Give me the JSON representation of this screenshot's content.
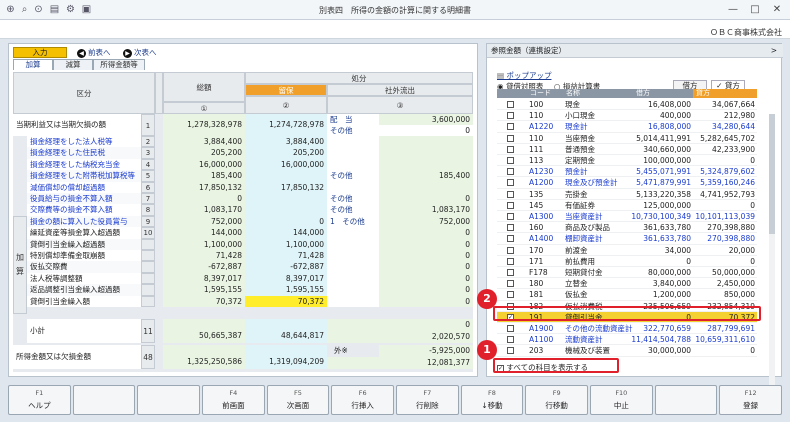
{
  "window": {
    "title": "別表四　所得の金額の計算に関する明細書",
    "company": "ＯＢＣ商事株式会社"
  },
  "nav": {
    "input": "入力",
    "prev": "前表へ",
    "next": "次表へ"
  },
  "tabs": [
    "加算",
    "減算",
    "所得金額等"
  ],
  "grid": {
    "header": {
      "kubun": "区分",
      "sougaku": "総額",
      "shobun": "処分",
      "ryuho": "留保",
      "shagai": "社外流出",
      "c1": "①",
      "c2": "②",
      "c3": "③"
    },
    "side_label": "加 算",
    "rows": [
      {
        "no": "1",
        "label": "当期利益又は当期欠損の額",
        "total": "1,278,328,978",
        "ryuho": "1,274,728,978",
        "shagai_label": "配　当",
        "shagai": "3,600,000",
        "shagai_label2": "その他",
        "shagai2": "0"
      },
      {
        "no": "2",
        "label": "損金経理をした法人税等",
        "total": "3,884,400",
        "ryuho": "3,884,400"
      },
      {
        "no": "3",
        "label": "損金経理をした住民税",
        "total": "205,200",
        "ryuho": "205,200"
      },
      {
        "no": "4",
        "label": "損金経理をした納税充当金",
        "total": "16,000,000",
        "ryuho": "16,000,000"
      },
      {
        "no": "5",
        "label": "損金経理をした附帯税加算税等",
        "total": "185,400",
        "ryuho": "",
        "shagai_label": "その他",
        "shagai": "185,400"
      },
      {
        "no": "6",
        "label": "減価償却の償却超過額",
        "total": "17,850,132",
        "ryuho": "17,850,132"
      },
      {
        "no": "7",
        "label": "役員給与の損金不算入額",
        "total": "0",
        "ryuho": "",
        "shagai_label": "その他",
        "shagai": "0"
      },
      {
        "no": "8",
        "label": "交際費等の損金不算入額",
        "total": "1,083,170",
        "ryuho": "",
        "shagai_label": "その他",
        "shagai": "1,083,170"
      },
      {
        "no": "9",
        "label": "損金の額に算入した役員賞与",
        "total": "752,000",
        "ryuho": "0",
        "shagai_label": "1　その他",
        "shagai": "752,000"
      },
      {
        "no": "10",
        "label": "繰延資産等損金算入超過額",
        "total": "144,000",
        "ryuho": "144,000",
        "shagai": "0"
      },
      {
        "no": "",
        "label": "貸倒引当金繰入超過額",
        "total": "1,100,000",
        "ryuho": "1,100,000",
        "shagai": "0"
      },
      {
        "no": "",
        "label": "特別償却準備金取崩額",
        "total": "71,428",
        "ryuho": "71,428",
        "shagai": "0"
      },
      {
        "no": "",
        "label": "仮払交際費",
        "total": "-672,887",
        "ryuho": "-672,887",
        "shagai": "0"
      },
      {
        "no": "",
        "label": "法人税等調整額",
        "total": "8,397,017",
        "ryuho": "8,397,017",
        "shagai": "0"
      },
      {
        "no": "",
        "label": "返品調整引当金繰入超過額",
        "total": "1,595,155",
        "ryuho": "1,595,155",
        "shagai": "0"
      },
      {
        "no": "",
        "label": "貸倒引当金繰入額",
        "total": "70,372",
        "ryuho": "70,372",
        "shagai": "0"
      }
    ],
    "subtotal": {
      "no": "11",
      "label": "小計",
      "total": "50,665,387",
      "ryuho": "48,644,817",
      "shagai_top": "0",
      "shagai": "2,020,570"
    },
    "last": {
      "no": "48",
      "label": "所得金額又は欠損金額",
      "total": "1,325,250,586",
      "ryuho": "1,319,094,209",
      "gai_label": "外※",
      "shagai_top": "-5,925,000",
      "shagai": "12,081,377"
    }
  },
  "ref": {
    "title": "参照金額（連携設定）",
    "popup": "ポップアップ",
    "radio1": "貸借対照表",
    "radio2": "損益計算書",
    "seg1": "借方",
    "seg2": "貸方",
    "cols": [
      "コード",
      "名称",
      "借方",
      "貸方"
    ],
    "rows": [
      {
        "code": "100",
        "name": "現金",
        "debit": "16,408,000",
        "credit": "34,067,664"
      },
      {
        "code": "110",
        "name": "小口現金",
        "debit": "400,000",
        "credit": "212,980"
      },
      {
        "code": "A1220",
        "name": "現金計",
        "debit": "16,808,000",
        "credit": "34,280,644",
        "blue": true
      },
      {
        "code": "110",
        "name": "当座預金",
        "debit": "5,014,411,991",
        "credit": "5,282,645,702"
      },
      {
        "code": "111",
        "name": "普通預金",
        "debit": "340,660,000",
        "credit": "42,233,900"
      },
      {
        "code": "113",
        "name": "定期預金",
        "debit": "100,000,000",
        "credit": "0"
      },
      {
        "code": "A1230",
        "name": "預金計",
        "debit": "5,455,071,991",
        "credit": "5,324,879,602",
        "blue": true
      },
      {
        "code": "A1200",
        "name": "現金及び預金計",
        "debit": "5,471,879,991",
        "credit": "5,359,160,246",
        "blue": true
      },
      {
        "code": "135",
        "name": "売掛金",
        "debit": "5,133,220,358",
        "credit": "4,741,952,793"
      },
      {
        "code": "145",
        "name": "有価証券",
        "debit": "125,000,000",
        "credit": "0"
      },
      {
        "code": "A1300",
        "name": "当座資産計",
        "debit": "10,730,100,349",
        "credit": "10,101,113,039",
        "blue": true
      },
      {
        "code": "160",
        "name": "商品及び製品",
        "debit": "361,633,780",
        "credit": "270,398,880"
      },
      {
        "code": "A1400",
        "name": "棚卸資産計",
        "debit": "361,633,780",
        "credit": "270,398,880",
        "blue": true
      },
      {
        "code": "170",
        "name": "前渡金",
        "debit": "34,000",
        "credit": "20,000"
      },
      {
        "code": "171",
        "name": "前払費用",
        "debit": "0",
        "credit": "0"
      },
      {
        "code": "F178",
        "name": "短期貸付金",
        "debit": "80,000,000",
        "credit": "50,000,000"
      },
      {
        "code": "180",
        "name": "立替金",
        "debit": "3,840,000",
        "credit": "2,450,000"
      },
      {
        "code": "181",
        "name": "仮払金",
        "debit": "1,200,000",
        "credit": "850,000"
      },
      {
        "code": "182",
        "name": "仮払消費税",
        "debit": "235,506,659",
        "credit": "232,854,319"
      },
      {
        "code": "191",
        "name": "貸倒引当金",
        "debit": "0",
        "credit": "70,372",
        "checked": true,
        "highlight": true
      },
      {
        "code": "A1900",
        "name": "その他の流動資産計",
        "debit": "322,770,659",
        "credit": "287,799,691",
        "blue": true
      },
      {
        "code": "A1100",
        "name": "流動資産計",
        "debit": "11,414,504,788",
        "credit": "10,659,311,610",
        "blue": true
      },
      {
        "code": "203",
        "name": "機械及び装置",
        "debit": "30,000,000",
        "credit": "0"
      }
    ],
    "show_all": "すべての科目を表示する",
    "badge1": "1",
    "badge2": "2"
  },
  "fkeys": [
    {
      "key": "F1",
      "label": "ヘルプ"
    },
    {
      "key": "",
      "label": ""
    },
    {
      "key": "",
      "label": ""
    },
    {
      "key": "F4",
      "label": "前画面"
    },
    {
      "key": "F5",
      "label": "次画面"
    },
    {
      "key": "F6",
      "label": "行挿入"
    },
    {
      "key": "F7",
      "label": "行削除"
    },
    {
      "key": "F8",
      "label": "↓移動"
    },
    {
      "key": "F9",
      "label": "行移動"
    },
    {
      "key": "F10",
      "label": "中止"
    },
    {
      "key": "",
      "label": ""
    },
    {
      "key": "F12",
      "label": "登録"
    }
  ]
}
